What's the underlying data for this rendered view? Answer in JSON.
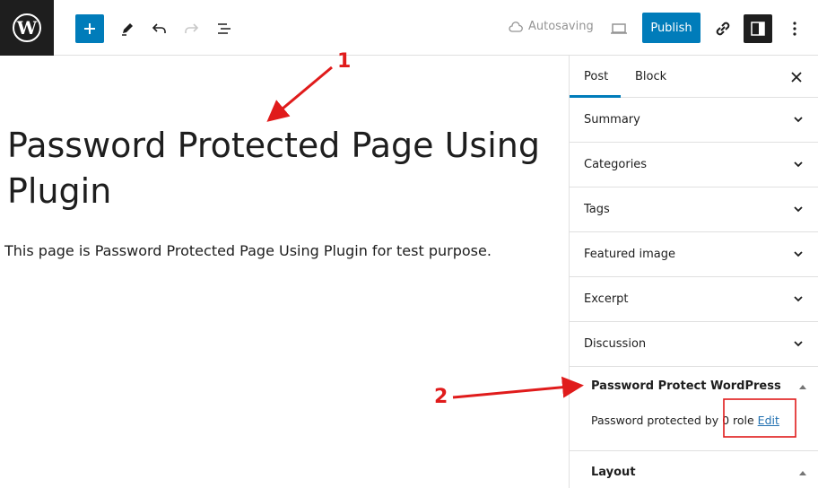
{
  "toolbar": {
    "autosave_label": "Autosaving",
    "publish_label": "Publish"
  },
  "post": {
    "title": "Password Protected Page Using Plugin",
    "paragraph": "This page is Password Protected Page Using Plugin for test purpose."
  },
  "sidebar": {
    "tabs": [
      {
        "label": "Post",
        "active": true
      },
      {
        "label": "Block",
        "active": false
      }
    ],
    "panels": [
      {
        "label": "Summary"
      },
      {
        "label": "Categories"
      },
      {
        "label": "Tags"
      },
      {
        "label": "Featured image"
      },
      {
        "label": "Excerpt"
      },
      {
        "label": "Discussion"
      }
    ],
    "ppw": {
      "title": "Password Protect WordPress",
      "text": "Password protected by 0 role",
      "edit_label": "Edit"
    },
    "layout": {
      "title": "Layout"
    }
  },
  "annotations": {
    "num1": "1",
    "num2": "2",
    "color": "#e01b1b"
  },
  "colors": {
    "accent": "#007cba",
    "dark": "#1e1e1e"
  }
}
